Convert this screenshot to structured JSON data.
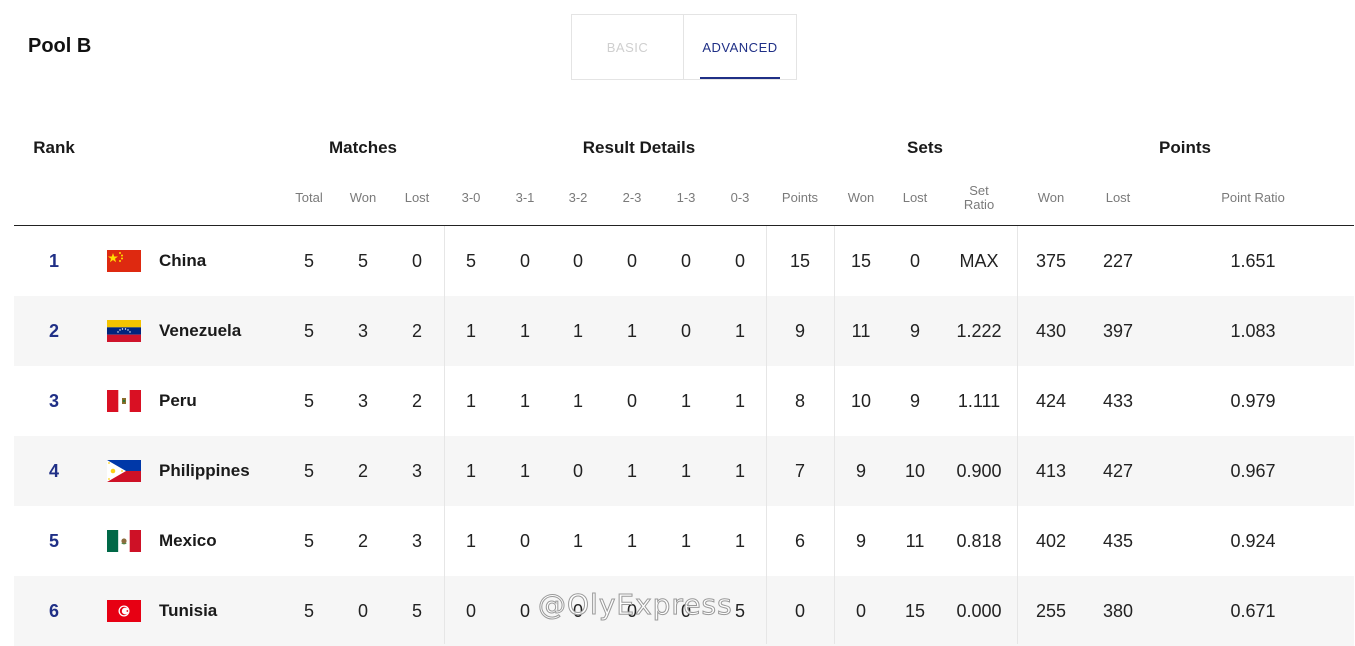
{
  "pool_title": "Pool B",
  "tabs": {
    "basic": "BASIC",
    "advanced": "ADVANCED"
  },
  "headers": {
    "rank": "Rank",
    "matches": "Matches",
    "result_details": "Result Details",
    "sets": "Sets",
    "points": "Points"
  },
  "subheaders": {
    "total": "Total",
    "won": "Won",
    "lost": "Lost",
    "r30": "3-0",
    "r31": "3-1",
    "r32": "3-2",
    "r23": "2-3",
    "r13": "1-3",
    "r03": "0-3",
    "points": "Points",
    "sets_won": "Won",
    "sets_lost": "Lost",
    "set_ratio_1": "Set",
    "set_ratio_2": "Ratio",
    "pts_won": "Won",
    "pts_lost": "Lost",
    "point_ratio": "Point Ratio"
  },
  "rows": [
    {
      "rank": "1",
      "country": "China",
      "flag": "china-flag",
      "total": "5",
      "won": "5",
      "lost": "0",
      "r30": "5",
      "r31": "0",
      "r32": "0",
      "r23": "0",
      "r13": "0",
      "r03": "0",
      "points": "15",
      "sets_won": "15",
      "sets_lost": "0",
      "set_ratio": "MAX",
      "pts_won": "375",
      "pts_lost": "227",
      "point_ratio": "1.651"
    },
    {
      "rank": "2",
      "country": "Venezuela",
      "flag": "venezuela-flag",
      "total": "5",
      "won": "3",
      "lost": "2",
      "r30": "1",
      "r31": "1",
      "r32": "1",
      "r23": "1",
      "r13": "0",
      "r03": "1",
      "points": "9",
      "sets_won": "11",
      "sets_lost": "9",
      "set_ratio": "1.222",
      "pts_won": "430",
      "pts_lost": "397",
      "point_ratio": "1.083"
    },
    {
      "rank": "3",
      "country": "Peru",
      "flag": "peru-flag",
      "total": "5",
      "won": "3",
      "lost": "2",
      "r30": "1",
      "r31": "1",
      "r32": "1",
      "r23": "0",
      "r13": "1",
      "r03": "1",
      "points": "8",
      "sets_won": "10",
      "sets_lost": "9",
      "set_ratio": "1.111",
      "pts_won": "424",
      "pts_lost": "433",
      "point_ratio": "0.979"
    },
    {
      "rank": "4",
      "country": "Philippines",
      "flag": "philippines-flag",
      "total": "5",
      "won": "2",
      "lost": "3",
      "r30": "1",
      "r31": "1",
      "r32": "0",
      "r23": "1",
      "r13": "1",
      "r03": "1",
      "points": "7",
      "sets_won": "9",
      "sets_lost": "10",
      "set_ratio": "0.900",
      "pts_won": "413",
      "pts_lost": "427",
      "point_ratio": "0.967"
    },
    {
      "rank": "5",
      "country": "Mexico",
      "flag": "mexico-flag",
      "total": "5",
      "won": "2",
      "lost": "3",
      "r30": "1",
      "r31": "0",
      "r32": "1",
      "r23": "1",
      "r13": "1",
      "r03": "1",
      "points": "6",
      "sets_won": "9",
      "sets_lost": "11",
      "set_ratio": "0.818",
      "pts_won": "402",
      "pts_lost": "435",
      "point_ratio": "0.924"
    },
    {
      "rank": "6",
      "country": "Tunisia",
      "flag": "tunisia-flag",
      "total": "5",
      "won": "0",
      "lost": "5",
      "r30": "0",
      "r31": "0",
      "r32": "0",
      "r23": "0",
      "r13": "0",
      "r03": "5",
      "points": "0",
      "sets_won": "0",
      "sets_lost": "15",
      "set_ratio": "0.000",
      "pts_won": "255",
      "pts_lost": "380",
      "point_ratio": "0.671"
    }
  ],
  "watermark": "@OlyExpress",
  "colors": {
    "accent": "#1f2f86",
    "row_alt": "#f6f6f6"
  }
}
